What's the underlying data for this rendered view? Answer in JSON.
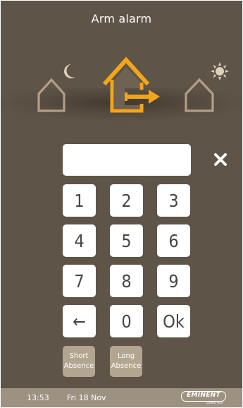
{
  "header": {
    "title": "Arm alarm"
  },
  "modes": [
    {
      "name": "night",
      "icon": "house-moon-icon",
      "selected": false
    },
    {
      "name": "away",
      "icon": "house-exit-arrow-icon",
      "selected": true
    },
    {
      "name": "day",
      "icon": "house-sun-icon",
      "selected": false
    }
  ],
  "code_input": {
    "value": "",
    "placeholder": ""
  },
  "clear": {
    "icon": "close-icon"
  },
  "keypad": {
    "k1": "1",
    "k2": "2",
    "k3": "3",
    "k4": "4",
    "k5": "5",
    "k6": "6",
    "k7": "7",
    "k8": "8",
    "k9": "9",
    "backspace": "←",
    "k0": "0",
    "ok": "Ok"
  },
  "absence": {
    "short": "Short\nAbsence",
    "long": "Long\nAbsence"
  },
  "status_bar": {
    "time": "13:53",
    "date": "Fri 18 Nov",
    "brand": "EMINENT",
    "brand_sub": "DOMOTICA"
  },
  "colors": {
    "background": "#5e5448",
    "selected_mode": "#f3a51a",
    "inactive_mode": "#b59d86",
    "status_bar": "#9d9282",
    "absence_button": "#b3a691"
  }
}
